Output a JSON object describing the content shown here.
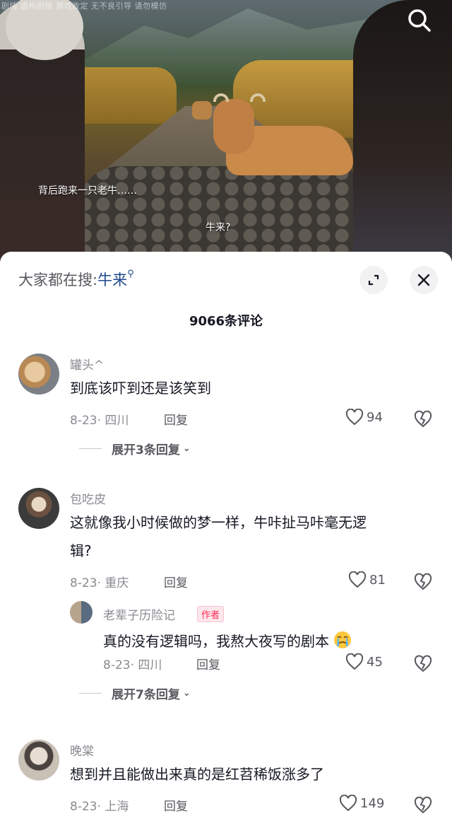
{
  "video": {
    "watermark": "剧情 虚构剧情 游戏改定 无不良引导 请勿模仿",
    "subtitle_1": "背后跑来一只老牛……",
    "subtitle_2": "牛来?"
  },
  "sheet": {
    "search_prefix": "大家都在搜:",
    "search_keyword": "牛来",
    "comment_count": "9066条评论"
  },
  "comments": [
    {
      "user": "罐头^",
      "text": "到底该吓到还是该笑到",
      "meta": "8-23· 四川",
      "reply_label": "回复",
      "likes": "94",
      "expand": "展开3条回复"
    },
    {
      "user": "包吃皮",
      "text_line1": "这就像我小时候做的梦一样，牛咔扯马咔毫无逻",
      "text_line2": "辑?",
      "meta": "8-23· 重庆",
      "reply_label": "回复",
      "likes": "81",
      "reply": {
        "user": "老辈子历险记",
        "tag": "作者",
        "text": "真的没有逻辑吗，我熬大夜写的剧本",
        "meta": "8-23· 四川",
        "reply_label": "回复",
        "likes": "45"
      },
      "expand": "展开7条回复"
    },
    {
      "user": "晚棠",
      "text": "想到并且能做出来真的是红苕稀饭涨多了",
      "meta": "8-23· 上海",
      "reply_label": "回复",
      "likes": "149"
    }
  ],
  "icons": {
    "search": "search-icon",
    "expand": "expand-icon",
    "close": "close-icon",
    "like": "heart-icon",
    "dislike": "broken-heart-icon",
    "emoji": "crying-face-emoji"
  },
  "colors": {
    "text": "#161823",
    "secondary": "#8a8b91",
    "keyword": "#1f4a8e",
    "author_tag": "#fe2c55"
  }
}
